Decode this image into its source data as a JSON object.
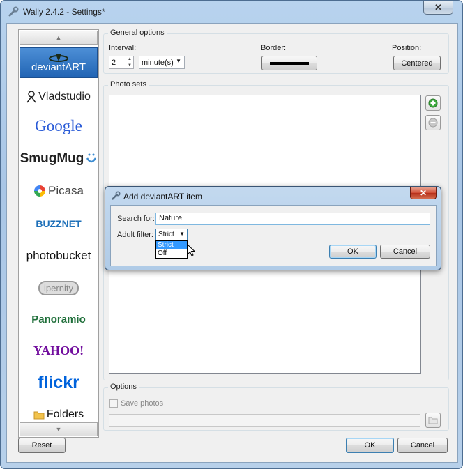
{
  "window": {
    "title": "Wally 2.4.2 - Settings*",
    "close_glyph": "✕"
  },
  "sidebar": {
    "scroll_up_glyph": "▲",
    "scroll_down_glyph": "▼",
    "items": [
      {
        "label": "deviantART",
        "icon": "deviantart-logo",
        "selected": true
      },
      {
        "label": "Vladstudio",
        "icon": "vladstudio-logo"
      },
      {
        "label": "Google",
        "icon": "google-logo"
      },
      {
        "label": "SmugMug",
        "icon": "smugmug-logo"
      },
      {
        "label": "Picasa",
        "icon": "picasa-logo"
      },
      {
        "label": "BUZZNET",
        "icon": "buzznet-logo"
      },
      {
        "label": "photobucket",
        "icon": "photobucket-logo"
      },
      {
        "label": "ipernity",
        "icon": "ipernity-logo"
      },
      {
        "label": "Panoramio",
        "icon": "panoramio-logo"
      },
      {
        "label": "YAHOO!",
        "icon": "yahoo-logo"
      },
      {
        "label": "flickr",
        "icon": "flickr-logo"
      },
      {
        "label": "Folders",
        "icon": "folder-icon"
      }
    ]
  },
  "general": {
    "title": "General options",
    "interval_label": "Interval:",
    "interval_value": "2",
    "interval_unit": "minute(s)",
    "border_label": "Border:",
    "position_label": "Position:",
    "position_value": "Centered"
  },
  "photo_sets": {
    "title": "Photo sets"
  },
  "options": {
    "title": "Options",
    "save_photos_label": "Save photos",
    "save_photos_checked": false
  },
  "footer": {
    "reset_label": "Reset",
    "ok_label": "OK",
    "cancel_label": "Cancel"
  },
  "dialog": {
    "title": "Add deviantART item",
    "close_glyph": "✕",
    "search_label": "Search for:",
    "search_value": "Nature",
    "adult_label": "Adult filter:",
    "adult_value": "Strict",
    "adult_options": [
      "Strict",
      "Off"
    ],
    "ok_label": "OK",
    "cancel_label": "Cancel"
  },
  "colors": {
    "deviantart_green": "#3c4c3a",
    "google_blue": "#2a5bd7",
    "google_red": "#d62d20",
    "google_yellow": "#f1b31c",
    "google_green": "#1a9a3c",
    "flickr_blue": "#0063dc",
    "flickr_pink": "#ff0084",
    "yahoo_purple": "#720e9e",
    "buzznet_blue": "#1d6fb8",
    "add_green": "#3aa63a"
  }
}
